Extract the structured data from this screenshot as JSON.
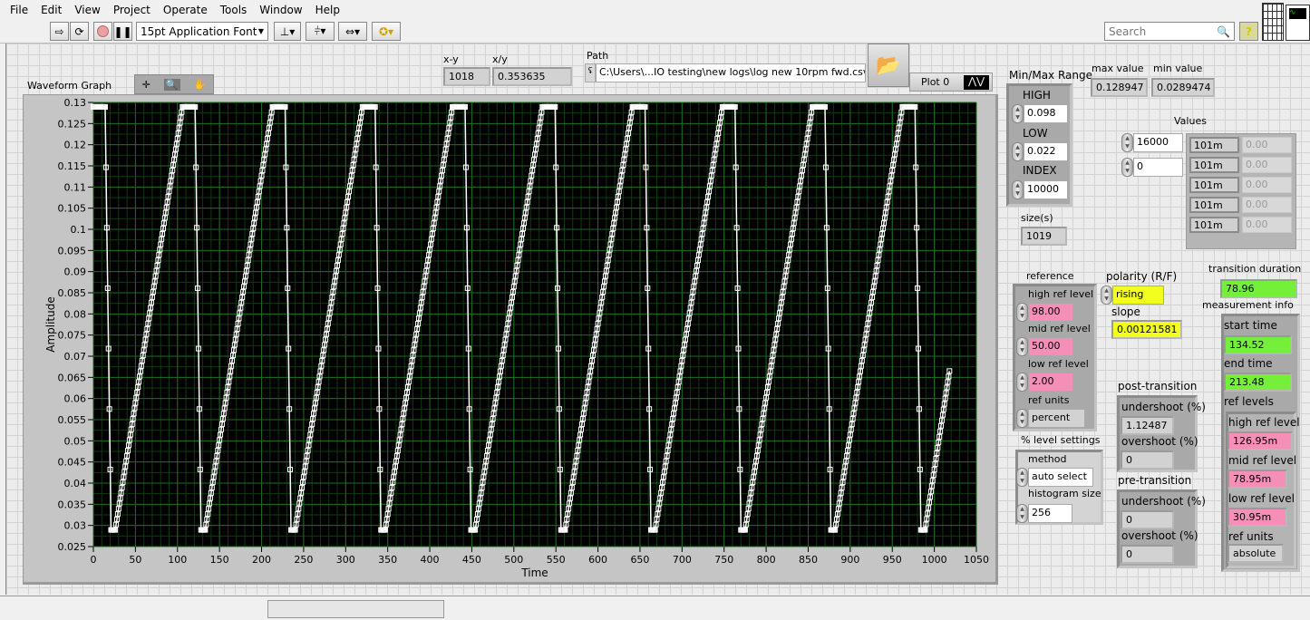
{
  "menu": [
    "File",
    "Edit",
    "View",
    "Project",
    "Operate",
    "Tools",
    "Window",
    "Help"
  ],
  "toolbar": {
    "font": "15pt Application Font",
    "search_placeholder": "Search",
    "icons": [
      "run-arrow-icon",
      "run-continuous-icon",
      "abort-icon",
      "pause-icon",
      "align-icon",
      "distribute-icon",
      "resize-icon",
      "reorder-icon",
      "help-icon"
    ]
  },
  "graph": {
    "label": "Waveform Graph",
    "plot_legend": "Plot 0",
    "xlabel": "Time",
    "ylabel": "Amplitude"
  },
  "cursor": {
    "xy_label": "x-y",
    "xy_value": "1018",
    "xdivy_label": "x/y",
    "xdivy_value": "0.353635"
  },
  "path": {
    "label": "Path",
    "value": "C:\\Users\\...IO testing\\new logs\\log new 10rpm fwd.csv"
  },
  "minmax": {
    "label": "Min/Max Range",
    "high_label": "HIGH",
    "high": "0.098",
    "low_label": "LOW",
    "low": "0.022",
    "index_label": "INDEX",
    "index": "10000"
  },
  "size": {
    "label": "size(s)",
    "value": "1019"
  },
  "max_value": {
    "label": "max value",
    "value": "0.128947"
  },
  "min_value": {
    "label": "min value",
    "value": "0.0289474"
  },
  "values": {
    "label": "Values",
    "index0": "16000",
    "index1": "0",
    "rows": [
      [
        "101m",
        "0.00"
      ],
      [
        "101m",
        "0.00"
      ],
      [
        "101m",
        "0.00"
      ],
      [
        "101m",
        "0.00"
      ],
      [
        "101m",
        "0.00"
      ]
    ]
  },
  "reference": {
    "label": "reference",
    "high_label": "high ref level",
    "high": "98.00",
    "mid_label": "mid ref level",
    "mid": "50.00",
    "low_label": "low ref level",
    "low": "2.00",
    "units_label": "ref units",
    "units": "percent"
  },
  "level_settings": {
    "label": "% level settings",
    "method_label": "method",
    "method": "auto select",
    "hist_label": "histogram size",
    "hist": "256"
  },
  "polarity": {
    "label": "polarity (R/F)",
    "value": "rising"
  },
  "slope": {
    "label": "slope",
    "value": "0.00121581"
  },
  "transition_duration": {
    "label": "transition duration",
    "value": "78.96"
  },
  "measurement": {
    "label": "measurement info",
    "start_label": "start time",
    "start": "134.52",
    "end_label": "end time",
    "end": "213.48",
    "ref_label": "ref levels",
    "high_label": "high ref level",
    "high": "126.95m",
    "mid_label": "mid ref level",
    "mid": "78.95m",
    "low_label": "low ref level",
    "low": "30.95m",
    "units_label": "ref units",
    "units": "absolute"
  },
  "post": {
    "label": "post-transition",
    "under_label": "undershoot (%)",
    "under": "1.12487",
    "over_label": "overshoot (%)",
    "over": "0"
  },
  "pre": {
    "label": "pre-transition",
    "under_label": "undershoot (%)",
    "under": "0",
    "over_label": "overshoot (%)",
    "over": "0"
  },
  "colors": {
    "plot_bg": "#000000",
    "grid": "#1f6a1f",
    "trace": "#ffffff",
    "pink": "#f58fb8",
    "yellow": "#f2ff1e",
    "green": "#74f03a"
  },
  "chart_data": {
    "type": "line",
    "xlabel": "Time",
    "ylabel": "Amplitude",
    "series_name": "Plot 0",
    "xlim": [
      0,
      1050
    ],
    "ylim": [
      0.025,
      0.13
    ],
    "grid": true,
    "markers": "square",
    "xticks": [
      0,
      50,
      100,
      150,
      200,
      250,
      300,
      350,
      400,
      450,
      500,
      550,
      600,
      650,
      700,
      750,
      800,
      850,
      900,
      950,
      1000,
      1050
    ],
    "yticks": [
      "0.025",
      "0.03",
      "0.035",
      "0.04",
      "0.045",
      "0.05",
      "0.055",
      "0.06",
      "0.065",
      "0.07",
      "0.075",
      "0.08",
      "0.085",
      "0.09",
      "0.095",
      "0.1",
      "0.105",
      "0.11",
      "0.115",
      "0.12",
      "0.125",
      "0.13"
    ],
    "sample_count": 1019,
    "vertices": [
      [
        0,
        0.128947
      ],
      [
        14,
        0.128947
      ],
      [
        21,
        0.0289474
      ],
      [
        26,
        0.0289474
      ],
      [
        106,
        0.128947
      ],
      [
        121,
        0.128947
      ],
      [
        128,
        0.0289474
      ],
      [
        133,
        0.0289474
      ],
      [
        213,
        0.128947
      ],
      [
        228,
        0.128947
      ],
      [
        235,
        0.0289474
      ],
      [
        240,
        0.0289474
      ],
      [
        320,
        0.128947
      ],
      [
        335,
        0.128947
      ],
      [
        342,
        0.0289474
      ],
      [
        347,
        0.0289474
      ],
      [
        427,
        0.128947
      ],
      [
        442,
        0.128947
      ],
      [
        449,
        0.0289474
      ],
      [
        454,
        0.0289474
      ],
      [
        534,
        0.128947
      ],
      [
        549,
        0.128947
      ],
      [
        556,
        0.0289474
      ],
      [
        561,
        0.0289474
      ],
      [
        641,
        0.128947
      ],
      [
        656,
        0.128947
      ],
      [
        663,
        0.0289474
      ],
      [
        668,
        0.0289474
      ],
      [
        748,
        0.128947
      ],
      [
        763,
        0.128947
      ],
      [
        770,
        0.0289474
      ],
      [
        775,
        0.0289474
      ],
      [
        855,
        0.128947
      ],
      [
        870,
        0.128947
      ],
      [
        877,
        0.0289474
      ],
      [
        882,
        0.0289474
      ],
      [
        962,
        0.128947
      ],
      [
        977,
        0.128947
      ],
      [
        984,
        0.0289474
      ],
      [
        989,
        0.0289474
      ],
      [
        1018,
        0.0665
      ]
    ]
  }
}
